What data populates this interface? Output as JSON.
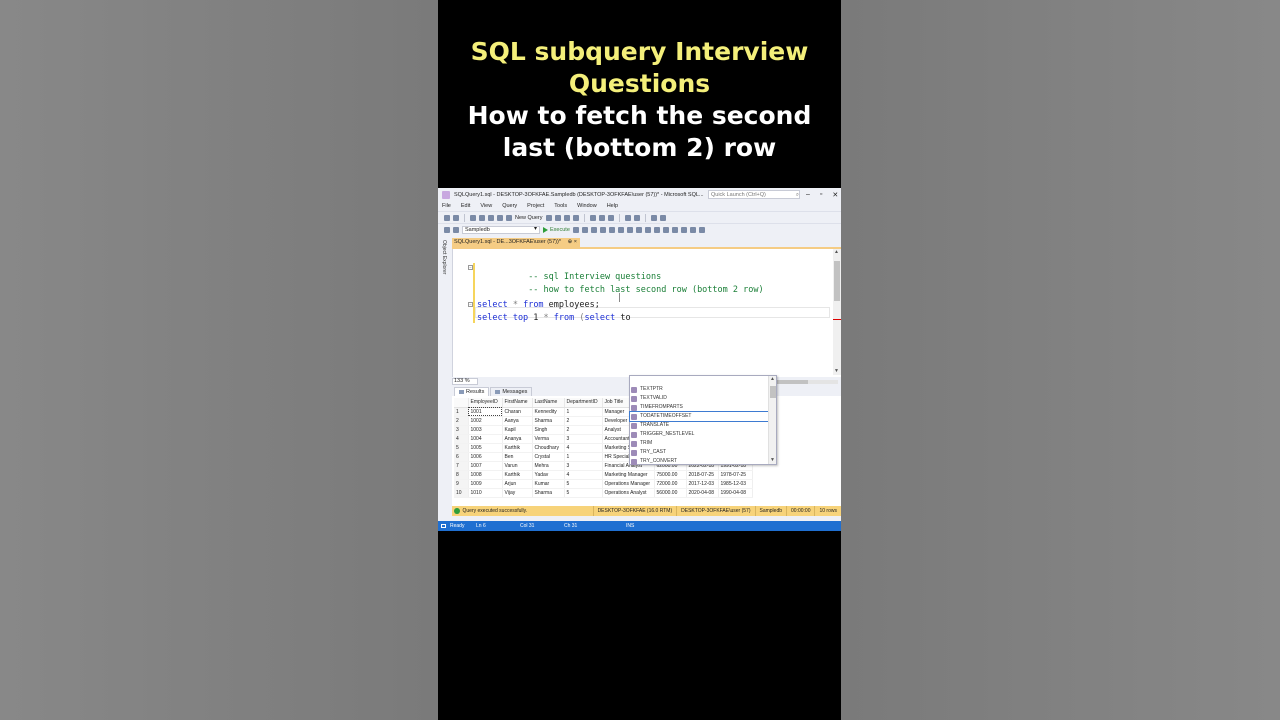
{
  "caption": {
    "line1": "SQL subquery Interview",
    "line2": "Questions",
    "line3": "How to fetch the second",
    "line4": "last (bottom 2) row"
  },
  "window": {
    "title": "SQLQuery1.sql - DESKTOP-3OFKFAE.Sampledb (DESKTOP-3OFKFAE\\user (57))* - Microsoft SQL...",
    "quick_launch_placeholder": "Quick Launch (Ctrl+Q)"
  },
  "menu": [
    "File",
    "Edit",
    "View",
    "Query",
    "Project",
    "Tools",
    "Window",
    "Help"
  ],
  "toolbar": {
    "new_query_label": "New Query",
    "database": "Sampledb",
    "execute_label": "Execute"
  },
  "object_explorer_label": "Object Explorer",
  "doc_tab": {
    "label": "SQLQuery1.sql - DE...3OFKFAE\\user (57))*",
    "pin": "⊕",
    "close": "×"
  },
  "code_lines": {
    "l1": "-- sql Interview questions",
    "l2": "-- how to fetch last second row (bottom 2 row)",
    "l4_kw1": "select",
    "l4_star": " * ",
    "l4_kw2": "from",
    "l4_rest": " employees;",
    "l5_kw1": "select top",
    "l5_num": " 1 ",
    "l5_star": "*",
    "l5_kw2": " from",
    "l5_paren": " (",
    "l5_kw3": "select",
    "l5_typed": " to"
  },
  "zoom": "133 %",
  "intellisense": {
    "items": [
      "TEXTPTR",
      "TEXTVALID",
      "TIMEFROMPARTS",
      "TODATETIMEOFFSET",
      "TRANSLATE",
      "TRIGGER_NESTLEVEL",
      "TRIM",
      "TRY_CAST",
      "TRY_CONVERT"
    ],
    "selected_index": 3
  },
  "results_tabs": [
    "Results",
    "Messages"
  ],
  "results": {
    "columns": [
      "EmployeeID",
      "FirstName",
      "LastName",
      "DepartmentID",
      "Job Title",
      "",
      "",
      ""
    ],
    "rows": [
      [
        "1",
        "1001",
        "Charan",
        "Kennedity",
        "1",
        "Manager",
        "",
        "",
        ""
      ],
      [
        "2",
        "1002",
        "Aanya",
        "Sharma",
        "2",
        "Developer",
        "60000.00",
        "2021-03-20",
        "1988-05-03"
      ],
      [
        "3",
        "1003",
        "Kapil",
        "Singh",
        "2",
        "Analyst",
        "56000.00",
        "2022-05-10",
        "1995-11-20"
      ],
      [
        "4",
        "1004",
        "Ananya",
        "Verma",
        "3",
        "Accountant",
        "65000.00",
        "2019-08-05",
        "1980-03-08"
      ],
      [
        "5",
        "1005",
        "Karthik",
        "Choudhary",
        "4",
        "Marketing Specialist",
        "58000.00",
        "2020-11-12",
        "1992-06-12"
      ],
      [
        "6",
        "1006",
        "Ben",
        "Crystal",
        "1",
        "HR Specialist",
        "52000.00",
        "2021-09-30",
        "1987-09-30"
      ],
      [
        "7",
        "1007",
        "Varun",
        "Mehra",
        "3",
        "Financial Analyst",
        "62000.00",
        "2022-02-18",
        "1991-02-18"
      ],
      [
        "8",
        "1008",
        "Karthik",
        "Yadav",
        "4",
        "Marketing Manager",
        "75000.00",
        "2018-07-25",
        "1978-07-25"
      ],
      [
        "9",
        "1009",
        "Arjun",
        "Kumar",
        "5",
        "Operations Manager",
        "72000.00",
        "2017-12-03",
        "1985-12-03"
      ],
      [
        "10",
        "1010",
        "Vijay",
        "Sharma",
        "5",
        "Operations Analyst",
        "56000.00",
        "2020-04-08",
        "1990-04-08"
      ]
    ]
  },
  "query_status": {
    "message": "Query executed successfully.",
    "server": "DESKTOP-3OFKFAE (16.0 RTM)",
    "user": "DESKTOP-3OFKFAE\\user (57)",
    "database": "Sampledb",
    "time": "00:00:00",
    "rows": "10 rows"
  },
  "statusbar": {
    "ready": "Ready",
    "ln": "Ln 6",
    "col": "Col 31",
    "ch": "Ch 31",
    "mode": "INS"
  }
}
